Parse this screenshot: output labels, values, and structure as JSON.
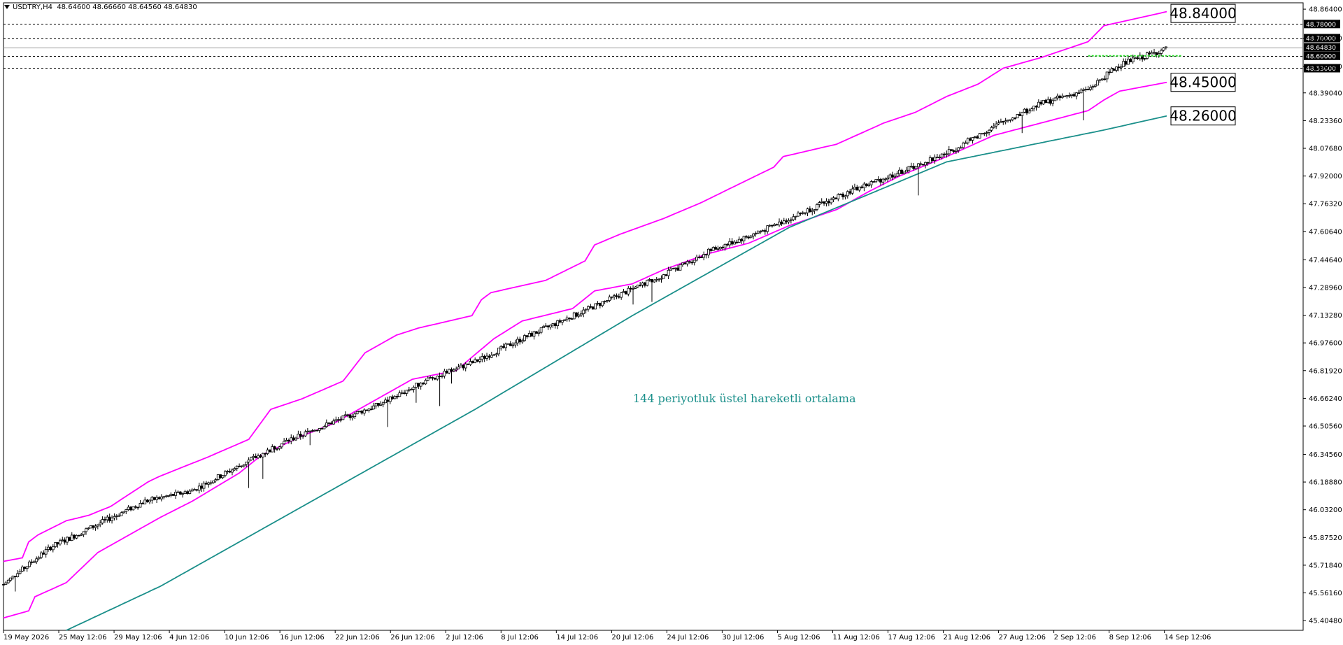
{
  "header": {
    "symbol": "USDTRY,H4",
    "open": "48.64600",
    "high": "48.66660",
    "low": "48.64560",
    "close": "48.64830"
  },
  "colors": {
    "envelope": "#ff00ff",
    "ema": "#1a8f8a",
    "candles": "#000000",
    "level_line": "#000000",
    "green_line": "#33dd33",
    "annotation": "#1a8f8a"
  },
  "annotation": "144 periyotluk üstel hareketli ortalama",
  "chart_data": {
    "type": "candlestick",
    "title": "USDTRY,H4",
    "xlabel": "",
    "ylabel": "",
    "ylim": [
      45.35,
      48.9
    ],
    "grid": false,
    "y_ticks": [
      "48.86400",
      "48.70000",
      "48.54000",
      "48.39040",
      "48.23360",
      "48.07680",
      "47.92000",
      "47.76320",
      "47.60640",
      "47.44640",
      "47.28960",
      "47.13280",
      "46.97600",
      "46.81920",
      "46.66240",
      "46.50560",
      "46.34560",
      "46.18880",
      "46.03200",
      "45.87520",
      "45.71840",
      "45.56160",
      "45.40480"
    ],
    "x_ticks": [
      "19 May 2026",
      "25 May 12:06",
      "29 May 12:06",
      "4 Jun 12:06",
      "10 Jun 12:06",
      "16 Jun 12:06",
      "22 Jun 12:06",
      "26 Jun 12:06",
      "2 Jul 12:06",
      "8 Jul 12:06",
      "14 Jul 12:06",
      "20 Jul 12:06",
      "24 Jul 12:06",
      "30 Jul 12:06",
      "5 Aug 12:06",
      "11 Aug 12:06",
      "17 Aug 12:06",
      "21 Aug 12:06",
      "27 Aug 12:06",
      "2 Sep 12:06",
      "8 Sep 12:06",
      "14 Sep 12:06"
    ],
    "price_levels": [
      {
        "value": 48.78,
        "label": "48.78000"
      },
      {
        "value": 48.7,
        "label": "48.70000"
      },
      {
        "value": 48.6,
        "label": "48.60000"
      },
      {
        "value": 48.53,
        "label": "48.53000"
      }
    ],
    "current_price": {
      "value": 48.6483,
      "label": "48.64830"
    },
    "green_level": 48.6,
    "callouts": [
      {
        "label": "48.84000",
        "value": 48.84,
        "series": "upper"
      },
      {
        "label": "48.45000",
        "value": 48.45,
        "series": "lower"
      },
      {
        "label": "48.26000",
        "value": 48.26,
        "series": "ema"
      }
    ],
    "series": [
      {
        "kind": "price",
        "x": [
          0,
          30,
          60,
          90,
          120,
          150,
          180,
          210,
          240,
          270,
          300,
          330,
          360,
          390,
          420,
          450,
          480,
          510,
          540,
          570,
          600,
          630,
          660,
          690,
          710,
          740
        ],
        "values": [
          45.61,
          45.82,
          45.95,
          46.08,
          46.14,
          46.28,
          46.42,
          46.53,
          46.63,
          46.77,
          46.87,
          47.0,
          47.12,
          47.24,
          47.36,
          47.5,
          47.6,
          47.72,
          47.84,
          47.94,
          48.05,
          48.2,
          48.33,
          48.41,
          48.55,
          48.64
        ]
      },
      {
        "kind": "upper",
        "x": [
          0,
          12,
          16,
          22,
          40,
          54,
          68,
          92,
          99,
          130,
          156,
          170,
          190,
          216,
          230,
          250,
          264,
          298,
          304,
          310,
          345,
          370,
          376,
          392,
          420,
          444,
          460,
          490,
          496,
          530,
          560,
          580,
          600,
          620,
          636,
          660,
          690,
          700,
          720,
          740
        ],
        "values": [
          45.74,
          45.76,
          45.85,
          45.89,
          45.97,
          46.0,
          46.05,
          46.19,
          46.22,
          46.33,
          46.43,
          46.6,
          46.66,
          46.76,
          46.92,
          47.02,
          47.06,
          47.13,
          47.22,
          47.26,
          47.33,
          47.44,
          47.53,
          47.59,
          47.68,
          47.77,
          47.84,
          47.97,
          48.03,
          48.1,
          48.22,
          48.28,
          48.37,
          48.44,
          48.53,
          48.59,
          48.68,
          48.77,
          48.81,
          48.85
        ]
      },
      {
        "kind": "lower",
        "x": [
          0,
          16,
          20,
          40,
          60,
          80,
          100,
          120,
          150,
          164,
          190,
          210,
          232,
          260,
          288,
          312,
          330,
          362,
          376,
          400,
          420,
          448,
          474,
          500,
          530,
          550,
          570,
          600,
          630,
          660,
          690,
          700,
          710,
          740
        ],
        "values": [
          45.42,
          45.46,
          45.54,
          45.62,
          45.79,
          45.89,
          45.99,
          46.08,
          46.24,
          46.34,
          46.45,
          46.52,
          46.63,
          46.77,
          46.82,
          47.0,
          47.1,
          47.17,
          47.27,
          47.31,
          47.39,
          47.48,
          47.54,
          47.64,
          47.73,
          47.83,
          47.92,
          48.03,
          48.15,
          48.22,
          48.29,
          48.35,
          48.4,
          48.45
        ]
      },
      {
        "kind": "ema",
        "x": [
          40,
          100,
          200,
          300,
          400,
          500,
          600,
          700,
          740
        ],
        "values": [
          45.35,
          45.6,
          46.1,
          46.6,
          47.13,
          47.63,
          48.0,
          48.18,
          48.26
        ]
      }
    ]
  }
}
